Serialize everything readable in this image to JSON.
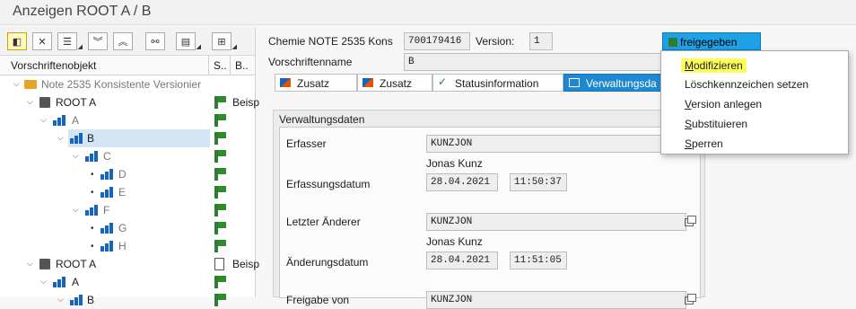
{
  "window": {
    "title": "Anzeigen ROOT A / B"
  },
  "tree": {
    "headers": {
      "col1": "Vorschriftenobjekt",
      "col2": "S..",
      "col3": "B.."
    },
    "rows": [
      {
        "label": "Note 2535 Konsistente Versionier",
        "extra": ""
      },
      {
        "label": "ROOT A",
        "extra": "Beisp"
      },
      {
        "label": "A",
        "extra": ""
      },
      {
        "label": "B",
        "extra": ""
      },
      {
        "label": "C",
        "extra": ""
      },
      {
        "label": "D",
        "extra": ""
      },
      {
        "label": "E",
        "extra": ""
      },
      {
        "label": "F",
        "extra": ""
      },
      {
        "label": "G",
        "extra": ""
      },
      {
        "label": "H",
        "extra": ""
      },
      {
        "label": "ROOT A",
        "extra": "Beisp"
      },
      {
        "label": "A",
        "extra": ""
      },
      {
        "label": "B",
        "extra": ""
      }
    ]
  },
  "header": {
    "object_label": "Chemie NOTE 2535 Kons",
    "object_value": "700179416",
    "version_label": "Version:",
    "version_value": "1",
    "status": "freigegeben",
    "name_label": "Vorschriftenname",
    "name_value": "B"
  },
  "tabs": [
    "Zusatz",
    "Zusatz",
    "Statusinformation",
    "Verwaltungsda"
  ],
  "admin": {
    "section_title": "Verwaltungsdaten",
    "creator_label": "Erfasser",
    "creator_value": "KUNZJON",
    "creator_name": "Jonas Kunz",
    "created_label": "Erfassungsdatum",
    "created_date": "28.04.2021",
    "created_time": "11:50:37",
    "changer_label": "Letzter Änderer",
    "changer_value": "KUNZJON",
    "changer_name": "Jonas Kunz",
    "changed_label": "Änderungsdatum",
    "changed_date": "28.04.2021",
    "changed_time": "11:51:05",
    "release_label": "Freigabe von",
    "release_value": "KUNZJON"
  },
  "menu": {
    "items": [
      {
        "mnemonic": "M",
        "rest": "odifizieren"
      },
      {
        "mnemonic": "",
        "rest": "Löschkennzeichen setzen"
      },
      {
        "mnemonic": "V",
        "rest": "ersion anlegen"
      },
      {
        "mnemonic": "S",
        "rest": "ubstituieren"
      },
      {
        "mnemonic": "S",
        "rest": "perren"
      }
    ]
  },
  "colors": {
    "status_bg": "#1ea1e6",
    "active_tab": "#1e88d0",
    "highlight": "#ffff5a",
    "selected_row": "#d4e6f4",
    "flag": "#2e7d32"
  }
}
